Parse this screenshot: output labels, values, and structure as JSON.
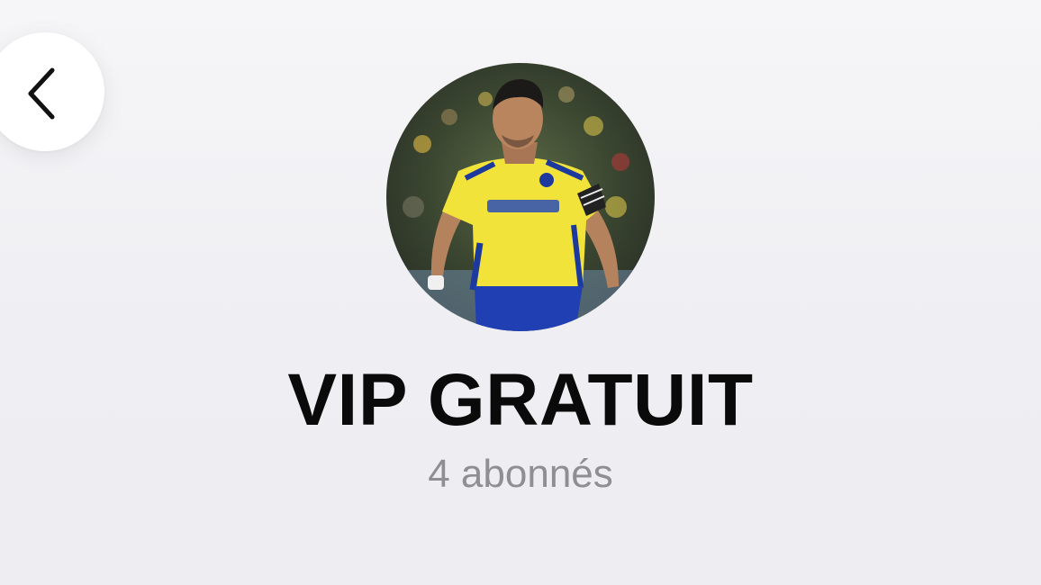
{
  "header": {
    "back_icon": "chevron-left-icon"
  },
  "channel": {
    "avatar_icon": "channel-avatar-photo",
    "title": "VIP GRATUIT",
    "subscribers": "4 abonnés",
    "avatar_colors": {
      "jersey": "#f2e33a",
      "shorts": "#1f3fb3",
      "stripes": "#1c3a9e",
      "background": "#3d4a35"
    }
  },
  "colors": {
    "background": "#f2f2f6",
    "title": "#0a0a0a",
    "subtitle": "#8e8e93"
  }
}
